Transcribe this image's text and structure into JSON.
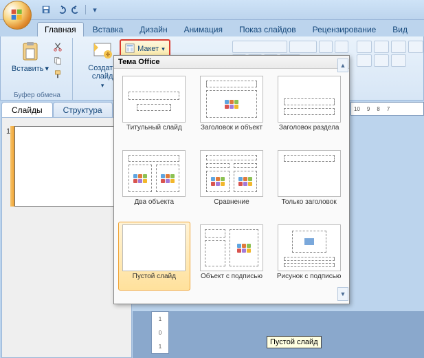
{
  "qat": {
    "items": [
      "save",
      "undo",
      "redo",
      "menu"
    ]
  },
  "tabs": [
    "Главная",
    "Вставка",
    "Дизайн",
    "Анимация",
    "Показ слайдов",
    "Рецензирование",
    "Вид"
  ],
  "activeTabIndex": 0,
  "groups": {
    "clipboard": {
      "paste": "Вставить",
      "label": "Буфер обмена"
    },
    "slides": {
      "new_slide": "Создать\nслайд",
      "layout": "Макет"
    }
  },
  "gallery": {
    "title": "Тема Office",
    "selectedIndex": 6,
    "items": [
      "Титульный слайд",
      "Заголовок и объект",
      "Заголовок раздела",
      "Два объекта",
      "Сравнение",
      "Только заголовок",
      "Пустой слайд",
      "Объект с подписью",
      "Рисунок с подписью"
    ]
  },
  "tooltip": "Пустой слайд",
  "sidepanel": {
    "tabs": [
      "Слайды",
      "Структура"
    ],
    "activeIndex": 0,
    "slide_number": "1"
  },
  "ruler_h": [
    "10",
    "9",
    "8",
    "7"
  ],
  "ruler_v": [
    "1",
    "0",
    "1"
  ]
}
